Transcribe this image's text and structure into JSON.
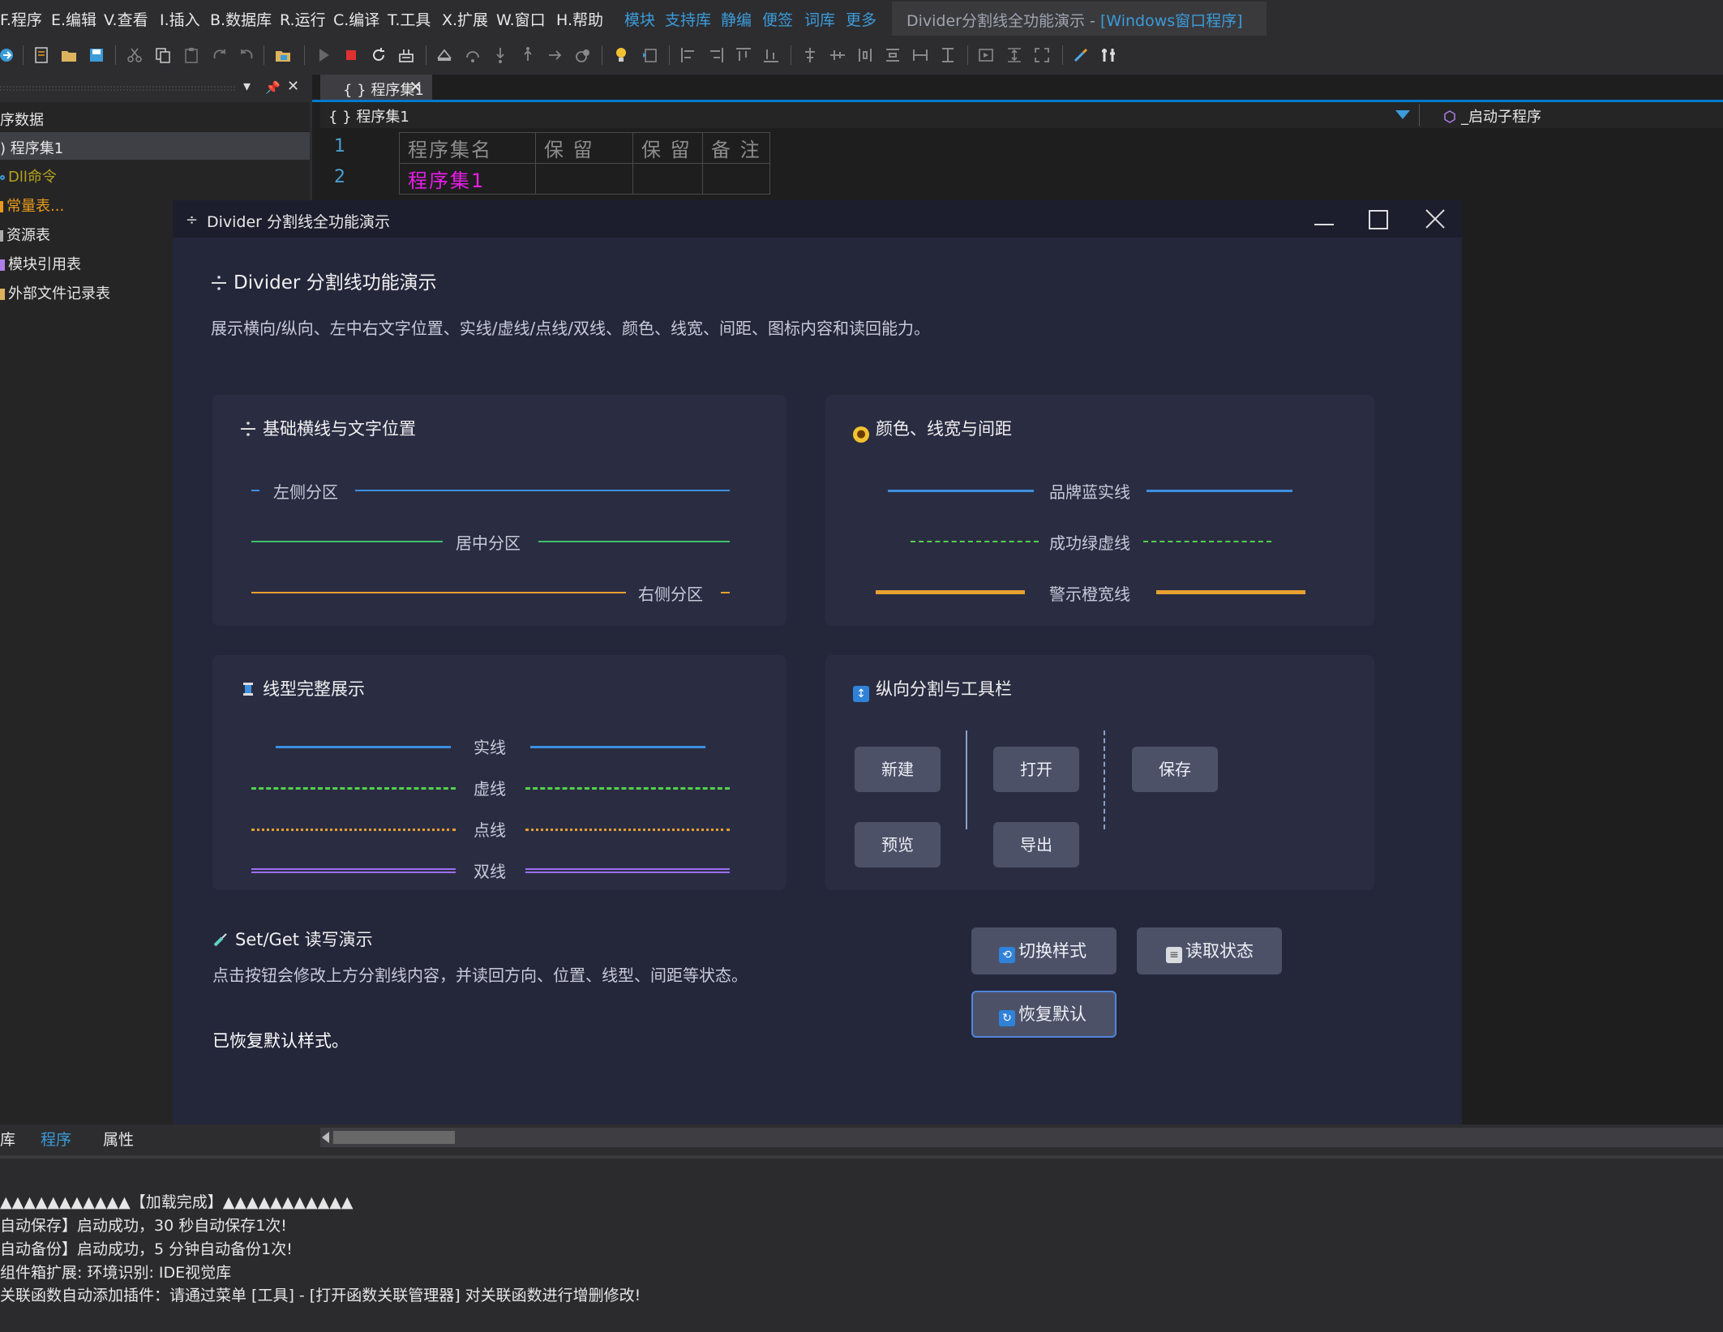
{
  "menubar": {
    "items": [
      "F.程序",
      "E.编辑",
      "V.查看",
      "I.插入",
      "B.数据库",
      "R.运行",
      "C.编译",
      "T.工具",
      "X.扩展",
      "W.窗口",
      "H.帮助"
    ],
    "extra": [
      "模块",
      "支持库",
      "静编",
      "便签",
      "词库",
      "更多"
    ],
    "window_title_prefix": "Divider分割线全功能演示 - ",
    "window_title_suffix": "[Windows窗口程序]"
  },
  "left_panel": {
    "header_pin": "📌",
    "header_close": "✕",
    "header_menu": "▾",
    "items": [
      {
        "label": "序数据",
        "color": "#e6e6e6"
      },
      {
        "label": ") 程序集1",
        "color": "#e6e6e6"
      },
      {
        "label": "Dll命令",
        "color": "#b4a21e"
      },
      {
        "label": "常量表...",
        "color": "#e89a1c"
      },
      {
        "label": "资源表",
        "color": "#e6e6e6"
      },
      {
        "label": "模块引用表",
        "color": "#e6e6e6"
      },
      {
        "label": "外部文件记录表",
        "color": "#e6e6e6"
      }
    ]
  },
  "editor": {
    "tab_label": "{ } 程序集1",
    "tab_close": "✕",
    "nav_left": "{ } 程序集1",
    "nav_right": "_启动子程序",
    "line_numbers": [
      "1",
      "2"
    ],
    "table": {
      "headers": [
        "程序集名",
        "保 留",
        "保 留",
        "备 注"
      ],
      "row": [
        "程序集1",
        "",
        "",
        ""
      ]
    }
  },
  "bottom_tabs": [
    "库",
    "程序",
    "属性"
  ],
  "output_lines": [
    "▲▲▲▲▲▲▲▲▲▲▲【加载完成】▲▲▲▲▲▲▲▲▲▲▲",
    "自动保存】启动成功，30 秒自动保存1次!",
    "自动备份】启动成功，5 分钟自动备份1次!",
    "组件箱扩展:   环境识别:   IDE视觉库",
    "关联函数自动添加插件：请通过菜单 [工具] - [打开函数关联管理器] 对关联函数进行增删修改!"
  ],
  "window": {
    "title": "Divider 分割线全功能演示",
    "title_icon": "÷",
    "heading": "Divider 分割线功能演示",
    "description": "展示横向/纵向、左中右文字位置、实线/虚线/点线/双线、颜色、线宽、间距、图标内容和读回能力。",
    "card_basic": {
      "title": "基础横线与文字位置",
      "left_label": "左侧分区",
      "center_label": "居中分区",
      "right_label": "右侧分区"
    },
    "card_color": {
      "title": "颜色、线宽与间距",
      "blue_label": "品牌蓝实线",
      "green_label": "成功绿虚线",
      "orange_label": "警示橙宽线"
    },
    "card_styles": {
      "title": "线型完整展示",
      "solid_label": "实线",
      "dashed_label": "虚线",
      "dotted_label": "点线",
      "double_label": "双线"
    },
    "card_vertical": {
      "title": "纵向分割与工具栏",
      "buttons": {
        "new": "新建",
        "open": "打开",
        "save": "保存",
        "preview": "预览",
        "export": "导出"
      }
    },
    "setget": {
      "title": "Set/Get 读写演示",
      "description": "点击按钮会修改上方分割线内容，并读回方向、位置、线型、间距等状态。",
      "status": "已恢复默认样式。",
      "toggle_label": "切换样式",
      "read_label": "读取状态",
      "restore_label": "恢复默认"
    }
  },
  "colors": {
    "blue": "#3d8fe0",
    "green": "#3fbf6a",
    "orange": "#e8a030",
    "purple": "#9b6ff0",
    "bright_green": "#52d14a"
  }
}
